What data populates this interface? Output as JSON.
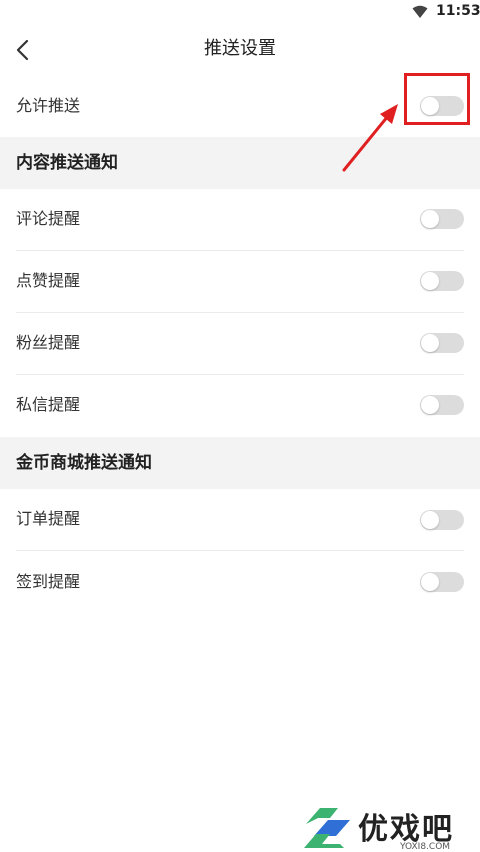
{
  "status_bar": {
    "time": "11:53",
    "wifi_icon": "wifi-icon"
  },
  "nav": {
    "title": "推送设置",
    "back_icon": "chevron-left-icon"
  },
  "allow_push": {
    "label": "允许推送",
    "enabled": false
  },
  "content_section": {
    "title": "内容推送通知",
    "items": [
      {
        "label": "评论提醒",
        "enabled": false
      },
      {
        "label": "点赞提醒",
        "enabled": false
      },
      {
        "label": "粉丝提醒",
        "enabled": false
      },
      {
        "label": "私信提醒",
        "enabled": false
      }
    ]
  },
  "mall_section": {
    "title": "金币商城推送通知",
    "items": [
      {
        "label": "订单提醒",
        "enabled": false
      },
      {
        "label": "签到提醒",
        "enabled": false
      }
    ]
  },
  "watermark": {
    "brand": "优戏吧",
    "site": "YOXI8.COM",
    "accent": "#3cb371"
  },
  "colors": {
    "annotation": "#e02020",
    "toggle_off": "#dcdcdc",
    "section_bg": "#f3f3f3"
  }
}
